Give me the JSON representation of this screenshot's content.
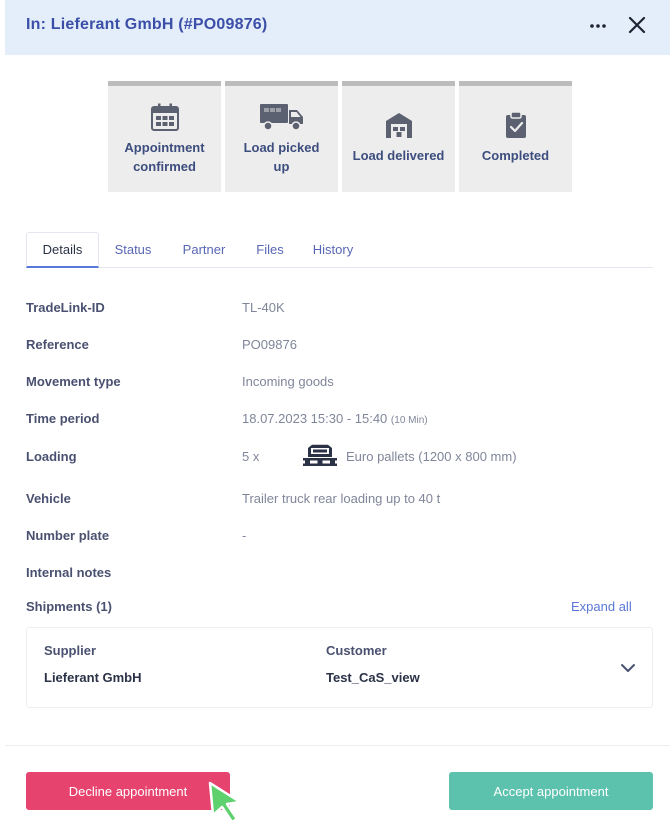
{
  "header": {
    "title": "In: Lieferant GmbH (#PO09876)",
    "more_icon": "more-horizontal-icon",
    "close_icon": "close-icon"
  },
  "steps": [
    {
      "label_lines": [
        "Appointment",
        "confirmed"
      ],
      "icon": "calendar-icon"
    },
    {
      "label_lines": [
        "Load picked",
        "up"
      ],
      "icon": "truck-icon"
    },
    {
      "label_lines": [
        "Load delivered"
      ],
      "icon": "warehouse-icon"
    },
    {
      "label_lines": [
        "Completed"
      ],
      "icon": "clipboard-check-icon"
    }
  ],
  "tabs": [
    {
      "label": "Details",
      "active": true
    },
    {
      "label": "Status",
      "active": false
    },
    {
      "label": "Partner",
      "active": false
    },
    {
      "label": "Files",
      "active": false
    },
    {
      "label": "History",
      "active": false
    }
  ],
  "details": {
    "tradelink_id": {
      "label": "TradeLink-ID",
      "value": "TL-40K"
    },
    "reference": {
      "label": "Reference",
      "value": "PO09876"
    },
    "movement_type": {
      "label": "Movement type",
      "value": "Incoming goods"
    },
    "time_period": {
      "label": "Time period",
      "value": "18.07.2023 15:30 - 15:40",
      "duration": "(10 Min)"
    },
    "loading": {
      "label": "Loading",
      "quantity": "5 x",
      "icon": "euro-pallet-icon",
      "value": "Euro pallets (1200 x 800 mm)"
    },
    "vehicle": {
      "label": "Vehicle",
      "value": "Trailer truck rear loading up to 40 t"
    },
    "number_plate": {
      "label": "Number plate",
      "value": "-"
    },
    "internal_notes": {
      "label": "Internal notes",
      "value": ""
    }
  },
  "shipments": {
    "title": "Shipments (1)",
    "expand_all": "Expand all",
    "items": [
      {
        "supplier_label": "Supplier",
        "supplier": "Lieferant GmbH",
        "customer_label": "Customer",
        "customer": "Test_CaS_view",
        "toggle_icon": "chevron-down-icon"
      }
    ]
  },
  "actions": {
    "decline": "Decline appointment",
    "accept": "Accept appointment"
  },
  "colors": {
    "header_bg": "#e3eefa",
    "title": "#3c4fa8",
    "decline": "#e6436f",
    "accept": "#5cc2ad",
    "link": "#5a78d6"
  }
}
